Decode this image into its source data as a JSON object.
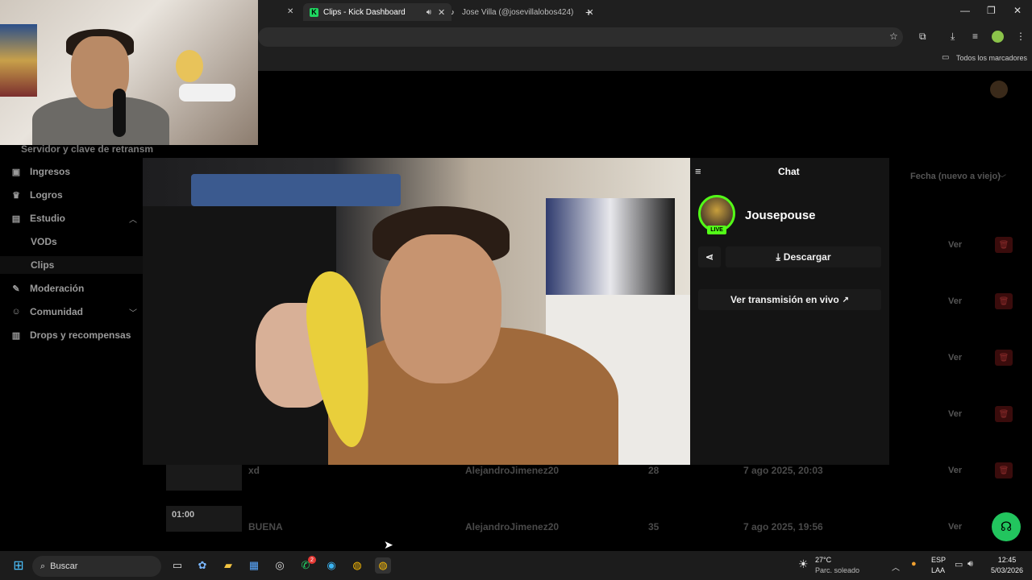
{
  "browser": {
    "tabs": [
      {
        "label": "Clips - Kick Dashboard",
        "active": true
      },
      {
        "label": "Jose Villa (@josevillalobos424)",
        "active": false
      }
    ],
    "new_tab": "+",
    "close_glyph": "✕",
    "bookmarks_all": "Todos los marcadores",
    "window_controls": [
      "—",
      "❐",
      "✕"
    ]
  },
  "sidebar": {
    "cut_text": "Servidor y clave de retransm",
    "items": [
      {
        "label": "Ingresos",
        "icon": "money-icon"
      },
      {
        "label": "Logros",
        "icon": "trophy-icon"
      },
      {
        "label": "Estudio",
        "icon": "studio-icon"
      },
      {
        "label": "VODs",
        "icon": ""
      },
      {
        "label": "Clips",
        "icon": ""
      },
      {
        "label": "Moderación",
        "icon": "wrench-icon"
      },
      {
        "label": "Comunidad",
        "icon": "people-icon"
      },
      {
        "label": "Drops y recompensas",
        "icon": "gift-icon"
      }
    ]
  },
  "table": {
    "sort_label": "Fecha (nuevo a viejo)",
    "view_label": "Ver",
    "rows": [
      {
        "title": "xd",
        "author": "AlejandroJimenez20",
        "views": "28",
        "date": "7 ago 2025, 20:03",
        "duration": ""
      },
      {
        "title": "BUENA",
        "author": "AlejandroJimenez20",
        "views": "35",
        "date": "7 ago 2025, 19:56",
        "duration": "01:00"
      }
    ]
  },
  "modal": {
    "chat_title": "Chat",
    "channel_name": "Jousepouse",
    "live_badge": "LIVE",
    "download_label": "Descargar",
    "watch_live_label": "Ver transmisión en vivo",
    "accent": "#53fc18"
  },
  "taskbar": {
    "search_placeholder": "Buscar",
    "weather_temp": "27°C",
    "weather_desc": "Parc. soleado",
    "lang_top": "ESP",
    "lang_bottom": "LAA",
    "time": "12:45",
    "date": "5/03/2026",
    "whatsapp_badge": "2"
  }
}
